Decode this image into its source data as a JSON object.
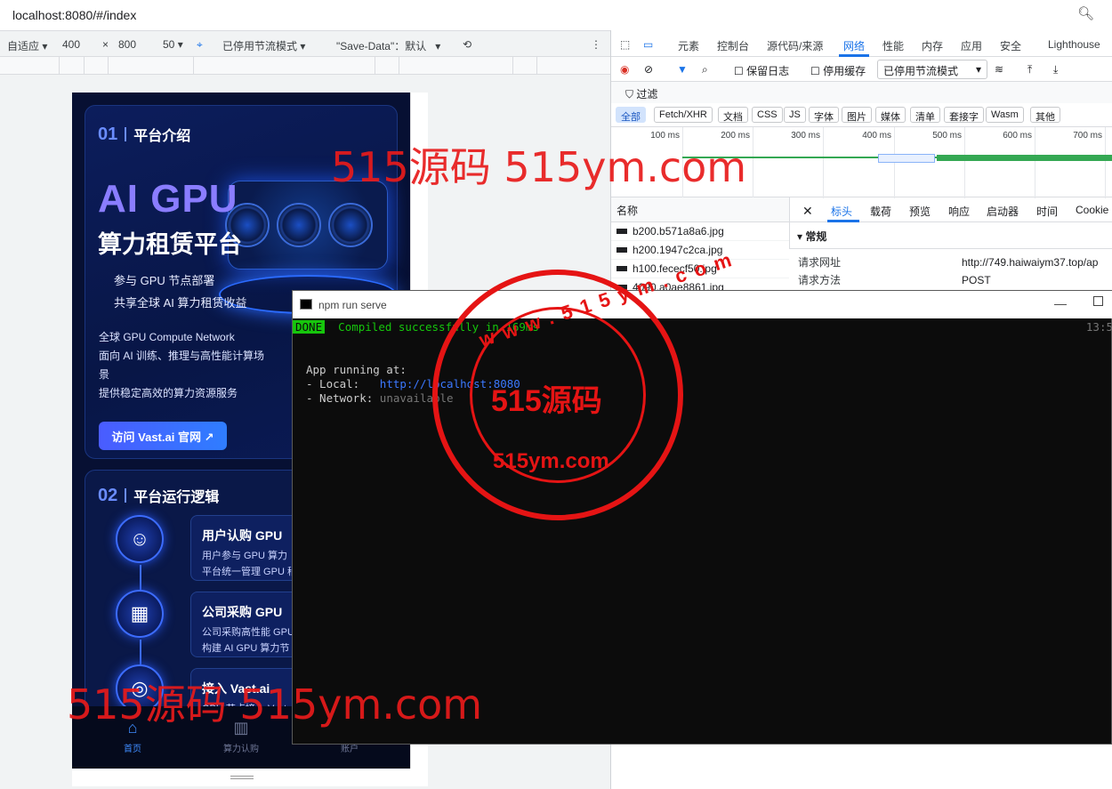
{
  "browser": {
    "url": "localhost:8080/#/index"
  },
  "device_toolbar": {
    "mode": "自适应",
    "width": "400",
    "height": "800",
    "zoom": "50",
    "throttle": "已停用节流模式",
    "save_data": "\"Save-Data\"：默认"
  },
  "app": {
    "sec1": {
      "num": "01",
      "title": "平台介绍"
    },
    "headline": "AI GPU",
    "subheadline": "算力租赁平台",
    "lines": [
      "参与 GPU 节点部署",
      "共享全球 AI 算力租赁收益"
    ],
    "desc": [
      "全球 GPU Compute Network",
      "面向 AI 训练、推理与高性能计算场",
      "景",
      "提供稳定高效的算力资源服务"
    ],
    "visit_button": "访问 Vast.ai 官网 ↗",
    "sec2": {
      "num": "02",
      "title": "平台运行逻辑"
    },
    "steps": [
      {
        "title": "用户认购 GPU",
        "desc1": "用户参与 GPU 算力",
        "desc2": "平台统一管理 GPU 稍"
      },
      {
        "title": "公司采购 GPU",
        "desc1": "公司采购高性能 GPU",
        "desc2": "构建 AI GPU 算力节"
      },
      {
        "title": "接入 Vast.ai",
        "desc1": "GPU 节点接入 Vast"
      }
    ],
    "tabs": [
      {
        "label": "首页",
        "icon": "home-icon"
      },
      {
        "label": "算力认购",
        "icon": "chart-icon"
      },
      {
        "label": "账户",
        "icon": "user-icon"
      }
    ]
  },
  "devtools": {
    "tabs": [
      "元素",
      "控制台",
      "源代码/来源",
      "网络",
      "性能",
      "内存",
      "应用",
      "安全",
      "Lighthouse"
    ],
    "active_tab": "网络",
    "preserve_log": "保留日志",
    "disable_cache": "停用缓存",
    "throttle": "已停用节流模式",
    "filter": "过滤",
    "types": [
      "全部",
      "Fetch/XHR",
      "文档",
      "CSS",
      "JS",
      "字体",
      "图片",
      "媒体",
      "清单",
      "套接字",
      "Wasm",
      "其他"
    ],
    "timeline_ticks": [
      "100 ms",
      "200 ms",
      "300 ms",
      "400 ms",
      "500 ms",
      "600 ms",
      "700 ms"
    ],
    "name_header": "名称",
    "requests": [
      "b200.b571a8a6.jpg",
      "h200.1947c2ca.jpg",
      "h100.fececf50.jpg",
      "4090.a0ae8861.jpg"
    ],
    "detail_tabs": [
      "标头",
      "载荷",
      "预览",
      "响应",
      "启动器",
      "时间",
      "Cookie"
    ],
    "general": "▾ 常规",
    "request_url_label": "请求网址",
    "request_url": "http://749.haiwaiym37.top/ap",
    "request_method_label": "请求方法",
    "request_method": "POST"
  },
  "terminal": {
    "title": "npm run serve",
    "done": "DONE",
    "compiled": "Compiled successfully in 169ms",
    "time": "13:5",
    "running": "App running at:",
    "local_label": "- Local:   ",
    "local_url": "http://localhost:8080",
    "network_label": "- Network: ",
    "network_val": "unavailable"
  },
  "watermarks": {
    "top": "515源码 515ym.com",
    "bottom": "515源码 515ym.com",
    "seal_center": "515源码",
    "seal_bottom": "515ym.com",
    "seal_ring": "www.515ym.com"
  },
  "colors": {
    "accent": "#1a73e8",
    "app_bg": "#071033",
    "terminal_green": "#16c60c",
    "watermark": "#e81b1b"
  }
}
